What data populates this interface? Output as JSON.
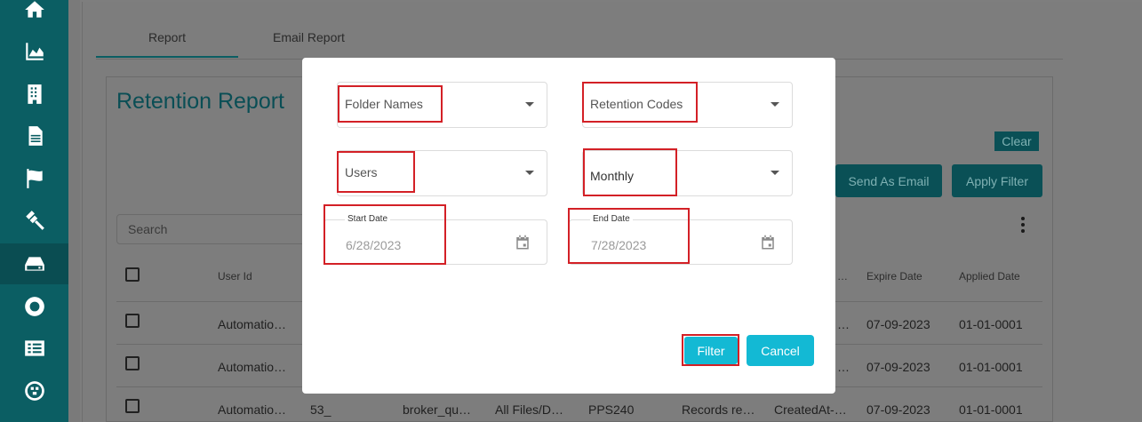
{
  "tabs": [
    {
      "label": "Report"
    },
    {
      "label": "Email Report"
    }
  ],
  "report": {
    "title": "Retention Report",
    "clear_label": "Clear",
    "send_email_label": "Send As Email",
    "apply_filter_label": "Apply Filter",
    "search_placeholder": "Search"
  },
  "table": {
    "headers": [
      "User Id",
      "Expire Date",
      "Applied Date"
    ],
    "rows": [
      {
        "user": "Automatio…",
        "expire": "07-09-2023",
        "applied": "01-01-0001"
      },
      {
        "user": "Automatio…",
        "expire": "07-09-2023",
        "applied": "01-01-0001"
      },
      {
        "user": "Automatio…",
        "col2": "53_",
        "col3": "broker_qu…",
        "col4": "All Files/D…",
        "col5": "PPS240",
        "col6": "Records re…",
        "col7": "CreatedAt-…",
        "expire": "07-09-2023",
        "applied": "01-01-0001"
      }
    ],
    "partial_header_ellipsis": "…",
    "partial_row_ellipsis": "…"
  },
  "modal": {
    "folder_names": "Folder Names",
    "retention_codes": "Retention Codes",
    "users": "Users",
    "period": "Monthly",
    "start_date_label": "Start Date",
    "start_date_value": "6/28/2023",
    "end_date_label": "End Date",
    "end_date_value": "7/28/2023",
    "filter_label": "Filter",
    "cancel_label": "Cancel"
  },
  "colors": {
    "sidebar": "#0b5e63",
    "accent_button": "#13b9d4",
    "highlight": "#d32026"
  },
  "icons": [
    "home-icon",
    "area-chart-icon",
    "building-icon",
    "document-icon",
    "flag-icon",
    "gavel-icon",
    "hard-drive-icon",
    "lifebuoy-icon",
    "list-icon",
    "network-icon",
    "calendar-icon",
    "dropdown-arrow-icon",
    "more-vertical-icon"
  ]
}
